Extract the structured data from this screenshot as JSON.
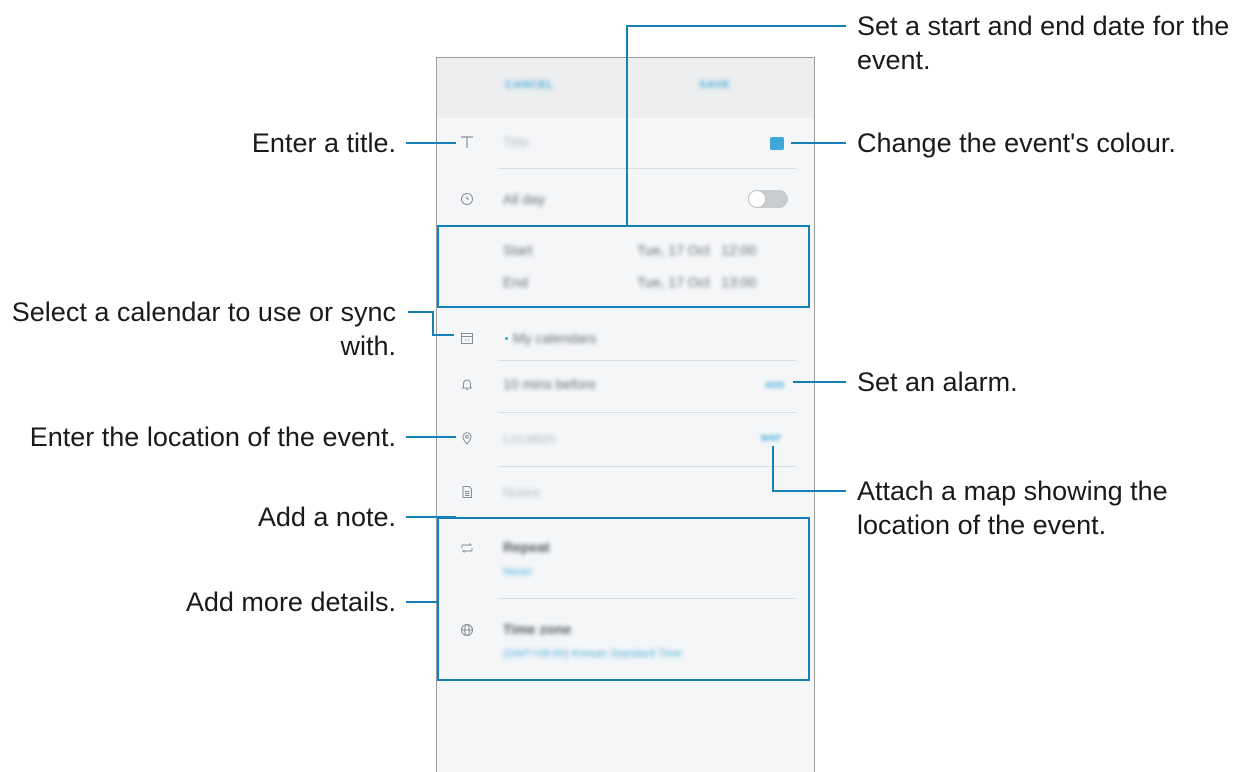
{
  "phone": {
    "topbar": {
      "cancel": "CANCEL",
      "save": "SAVE"
    },
    "title_placeholder": "Title",
    "all_day": "All day",
    "start_label": "Start",
    "start_value": "Tue, 17 Oct   12:00",
    "end_label": "End",
    "end_value": "Tue, 17 Oct   13:00",
    "calendar": "My calendars",
    "alarm": "10 mins before",
    "alarm_action": "ADD",
    "location_placeholder": "Location",
    "map_action": "MAP",
    "notes_placeholder": "Notes",
    "repeat_label": "Repeat",
    "repeat_value": "Never",
    "timezone_label": "Time zone",
    "timezone_value": "(GMT+09:00) Korean Standard Time"
  },
  "annotations": {
    "title": "Enter a title.",
    "calendar_line1": "Select a calendar to use or sync",
    "calendar_line2": "with.",
    "location": "Enter the location of the event.",
    "note": "Add a note.",
    "details": "Add more details.",
    "dates_line1": "Set a start and end date for the",
    "dates_line2": "event.",
    "colour": "Change the event's colour.",
    "alarm": "Set an alarm.",
    "map_line1": "Attach a map showing the",
    "map_line2": "location of the event."
  },
  "colors": {
    "accent": "#1580b8",
    "event_color": "#3ea8d6",
    "link_blue": "#4fb0dd"
  }
}
